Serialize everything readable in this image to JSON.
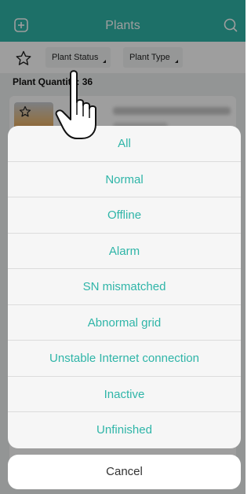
{
  "header": {
    "title": "Plants",
    "add_icon": "plus-square-icon",
    "search_icon": "search-icon"
  },
  "filters": {
    "favorite_icon": "star-outline-icon",
    "plant_status_label": "Plant Status",
    "plant_type_label": "Plant Type"
  },
  "summary": {
    "quantity_label": "Plant Quantity:",
    "quantity_value": "36"
  },
  "plant_card": {
    "favorite_icon": "star-outline-icon"
  },
  "status_sheet": {
    "options": [
      "All",
      "Normal",
      "Offline",
      "Alarm",
      "SN mismatched",
      "Abnormal grid",
      "Unstable Internet connection",
      "Inactive",
      "Unfinished"
    ],
    "cancel_label": "Cancel"
  },
  "colors": {
    "accent": "#2fb5a8",
    "overlay": "rgba(0,0,0,0.38)",
    "sheet_bg": "#f6f6f6"
  }
}
